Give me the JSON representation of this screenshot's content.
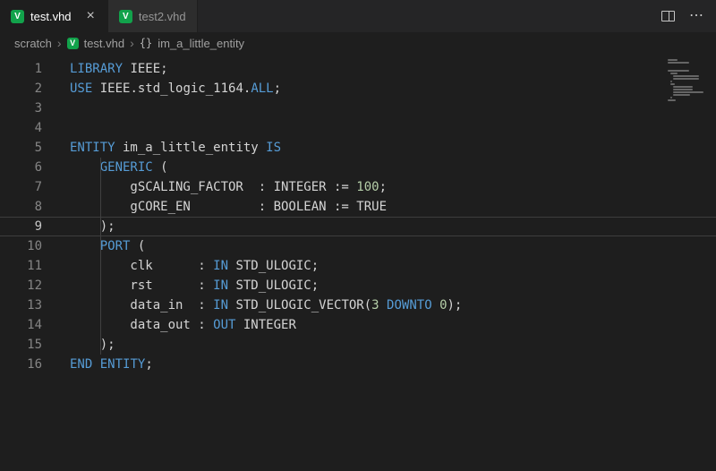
{
  "tabs": [
    {
      "label": "test.vhd",
      "active": true
    },
    {
      "label": "test2.vhd",
      "active": false
    }
  ],
  "tab_actions": {
    "close_icon": "×",
    "more_icon": "⋯"
  },
  "file_icon_glyph": "V",
  "breadcrumb": {
    "folder": "scratch",
    "separator": "›",
    "file": "test.vhd",
    "symbol_icon": "{}",
    "symbol": "im_a_little_entity"
  },
  "colors": {
    "keyword": "#569cd6",
    "default_text": "#d4d4d4",
    "number": "#b5cea8",
    "file_icon_green": "#12a24b",
    "line_number": "#858585",
    "active_line_number": "#c6c6c6",
    "editor_background": "#1e1e1e"
  },
  "editor": {
    "language": "vhdl",
    "current_line": 9,
    "lines": [
      {
        "num": "1",
        "tokens": [
          [
            "kw",
            "LIBRARY"
          ],
          [
            "tx",
            " IEEE;"
          ]
        ]
      },
      {
        "num": "2",
        "tokens": [
          [
            "kw",
            "USE"
          ],
          [
            "tx",
            " IEEE.std_logic_1164."
          ],
          [
            "kw",
            "ALL"
          ],
          [
            "tx",
            ";"
          ]
        ]
      },
      {
        "num": "3",
        "tokens": []
      },
      {
        "num": "4",
        "tokens": []
      },
      {
        "num": "5",
        "tokens": [
          [
            "kw",
            "ENTITY"
          ],
          [
            "tx",
            " im_a_little_entity "
          ],
          [
            "kw",
            "IS"
          ]
        ]
      },
      {
        "num": "6",
        "tokens": [
          [
            "tx",
            "    "
          ],
          [
            "kw",
            "GENERIC"
          ],
          [
            "tx",
            " ("
          ]
        ]
      },
      {
        "num": "7",
        "tokens": [
          [
            "tx",
            "        gSCALING_FACTOR  : INTEGER := "
          ],
          [
            "nm",
            "100"
          ],
          [
            "tx",
            ";"
          ]
        ]
      },
      {
        "num": "8",
        "tokens": [
          [
            "tx",
            "        gCORE_EN         : BOOLEAN := TRUE"
          ]
        ]
      },
      {
        "num": "9",
        "tokens": [
          [
            "tx",
            "    );"
          ]
        ],
        "current": true
      },
      {
        "num": "10",
        "tokens": [
          [
            "tx",
            "    "
          ],
          [
            "kw",
            "PORT"
          ],
          [
            "tx",
            " ("
          ]
        ]
      },
      {
        "num": "11",
        "tokens": [
          [
            "tx",
            "        clk      : "
          ],
          [
            "kw",
            "IN"
          ],
          [
            "tx",
            " STD_ULOGIC;"
          ]
        ]
      },
      {
        "num": "12",
        "tokens": [
          [
            "tx",
            "        rst      : "
          ],
          [
            "kw",
            "IN"
          ],
          [
            "tx",
            " STD_ULOGIC;"
          ]
        ]
      },
      {
        "num": "13",
        "tokens": [
          [
            "tx",
            "        data_in  : "
          ],
          [
            "kw",
            "IN"
          ],
          [
            "tx",
            " STD_ULOGIC_VECTOR("
          ],
          [
            "nm",
            "3"
          ],
          [
            "tx",
            " "
          ],
          [
            "kw",
            "DOWNTO"
          ],
          [
            "tx",
            " "
          ],
          [
            "nm",
            "0"
          ],
          [
            "tx",
            ");"
          ]
        ]
      },
      {
        "num": "14",
        "tokens": [
          [
            "tx",
            "        data_out : "
          ],
          [
            "kw",
            "OUT"
          ],
          [
            "tx",
            " INTEGER"
          ]
        ]
      },
      {
        "num": "15",
        "tokens": [
          [
            "tx",
            "    );"
          ]
        ]
      },
      {
        "num": "16",
        "tokens": [
          [
            "kw",
            "END"
          ],
          [
            "tx",
            " "
          ],
          [
            "kw",
            "ENTITY"
          ],
          [
            "tx",
            ";"
          ]
        ]
      }
    ]
  }
}
